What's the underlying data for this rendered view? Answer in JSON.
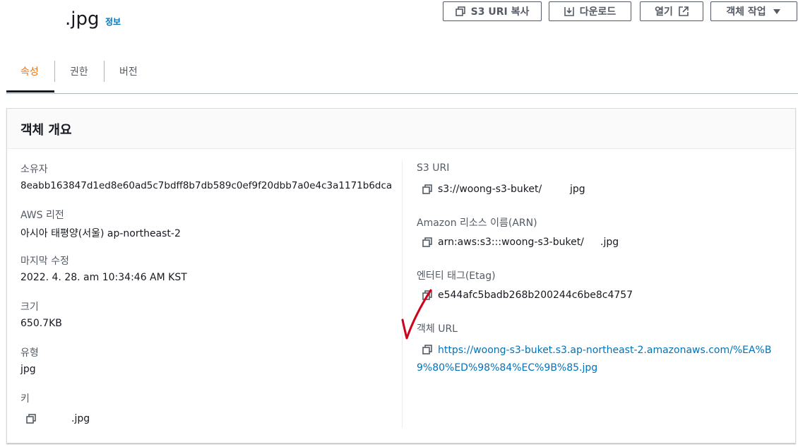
{
  "header": {
    "title": ".jpg",
    "info_link": "정보",
    "buttons": {
      "copy_s3_uri": "S3 URI 복사",
      "download": "다운로드",
      "open": "열기",
      "object_actions": "객체 작업"
    }
  },
  "tabs": [
    {
      "label": "속성",
      "active": true
    },
    {
      "label": "권한",
      "active": false
    },
    {
      "label": "버전",
      "active": false
    }
  ],
  "panel": {
    "title": "객체 개요",
    "left": [
      {
        "label": "소유자",
        "value": "8eabb163847d1ed8e60ad5c7bdff8b7db589c0ef9f20dbb7a0e4c3a1171b6dca"
      },
      {
        "label": "AWS 리전",
        "value": "아시아 태평양(서울) ap-northeast-2"
      },
      {
        "label": "마지막 수정",
        "value": "2022. 4. 28. am 10:34:46 AM KST"
      },
      {
        "label": "크기",
        "value": "650.7KB"
      },
      {
        "label": "유형",
        "value": "jpg"
      },
      {
        "label": "키",
        "value": ".jpg"
      }
    ],
    "right": {
      "s3_uri": {
        "label": "S3 URI",
        "value_prefix": "s3://woong-s3-buket/",
        "value_suffix": "jpg"
      },
      "arn": {
        "label": "Amazon 리소스 이름(ARN)",
        "value_prefix": "arn:aws:s3:::woong-s3-buket/",
        "value_suffix": ".jpg"
      },
      "etag": {
        "label": "엔터티 태그(Etag)",
        "value": "e544afc5badb268b200244c6be8c4757"
      },
      "object_url": {
        "label": "객체 URL",
        "value": "https://woong-s3-buket.s3.ap-northeast-2.amazonaws.com/%EA%B9%80%ED%98%84%EC%9B%85.jpg"
      }
    }
  },
  "colors": {
    "accent": "#ec7211",
    "link": "#0073bb",
    "text": "#16191f",
    "label": "#545b64",
    "annotation": "#d0021b"
  }
}
